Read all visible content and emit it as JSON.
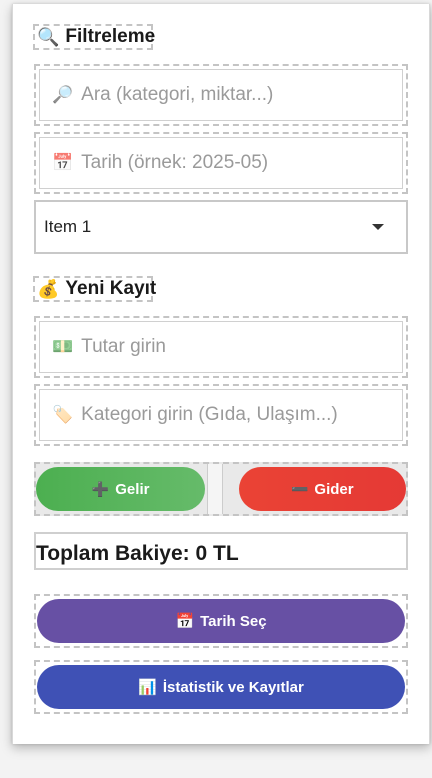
{
  "filter": {
    "heading": "Filtreleme",
    "heading_icon": "🔍",
    "search": {
      "icon": "🔎",
      "placeholder": "Ara (kategori, miktar...)"
    },
    "date": {
      "icon": "📅",
      "placeholder": "Tarih (örnek: 2025-05)"
    },
    "dropdown": {
      "selected": "Item 1"
    }
  },
  "new_entry": {
    "heading": "Yeni Kayıt",
    "heading_icon": "💰",
    "amount": {
      "icon": "💵",
      "placeholder": "Tutar girin"
    },
    "category": {
      "icon": "🏷️",
      "placeholder": "Kategori girin (Gıda, Ulaşım...)"
    }
  },
  "actions": {
    "income": {
      "icon": "➕",
      "label": "Gelir",
      "color": "#4caf50"
    },
    "expense": {
      "icon": "➖",
      "label": "Gider",
      "color": "#e53935"
    }
  },
  "balance": {
    "text": "Toplam Bakiye: 0 TL"
  },
  "date_button": {
    "icon": "📅",
    "label": "Tarih Seç",
    "color": "#6750a4"
  },
  "stats_button": {
    "icon": "📊",
    "label": "İstatistik ve Kayıtlar",
    "color": "#3f51b5"
  }
}
